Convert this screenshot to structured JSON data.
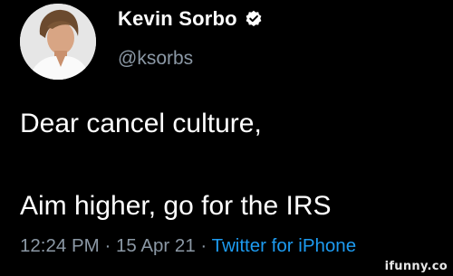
{
  "tweet": {
    "author": {
      "display_name": "Kevin Sorbo",
      "handle": "@ksorbs",
      "verified": true,
      "avatar_icon": "profile-photo"
    },
    "text_lines": [
      "Dear cancel culture,",
      "Aim higher, go for the IRS"
    ],
    "meta": {
      "time": "12:24 PM",
      "separator": " · ",
      "date": "15 Apr 21",
      "source": "Twitter for iPhone"
    }
  },
  "watermark": "ifunny.co",
  "colors": {
    "background": "#000000",
    "text": "#ffffff",
    "secondary_text": "#8b98a5",
    "link": "#1d9bf0"
  }
}
